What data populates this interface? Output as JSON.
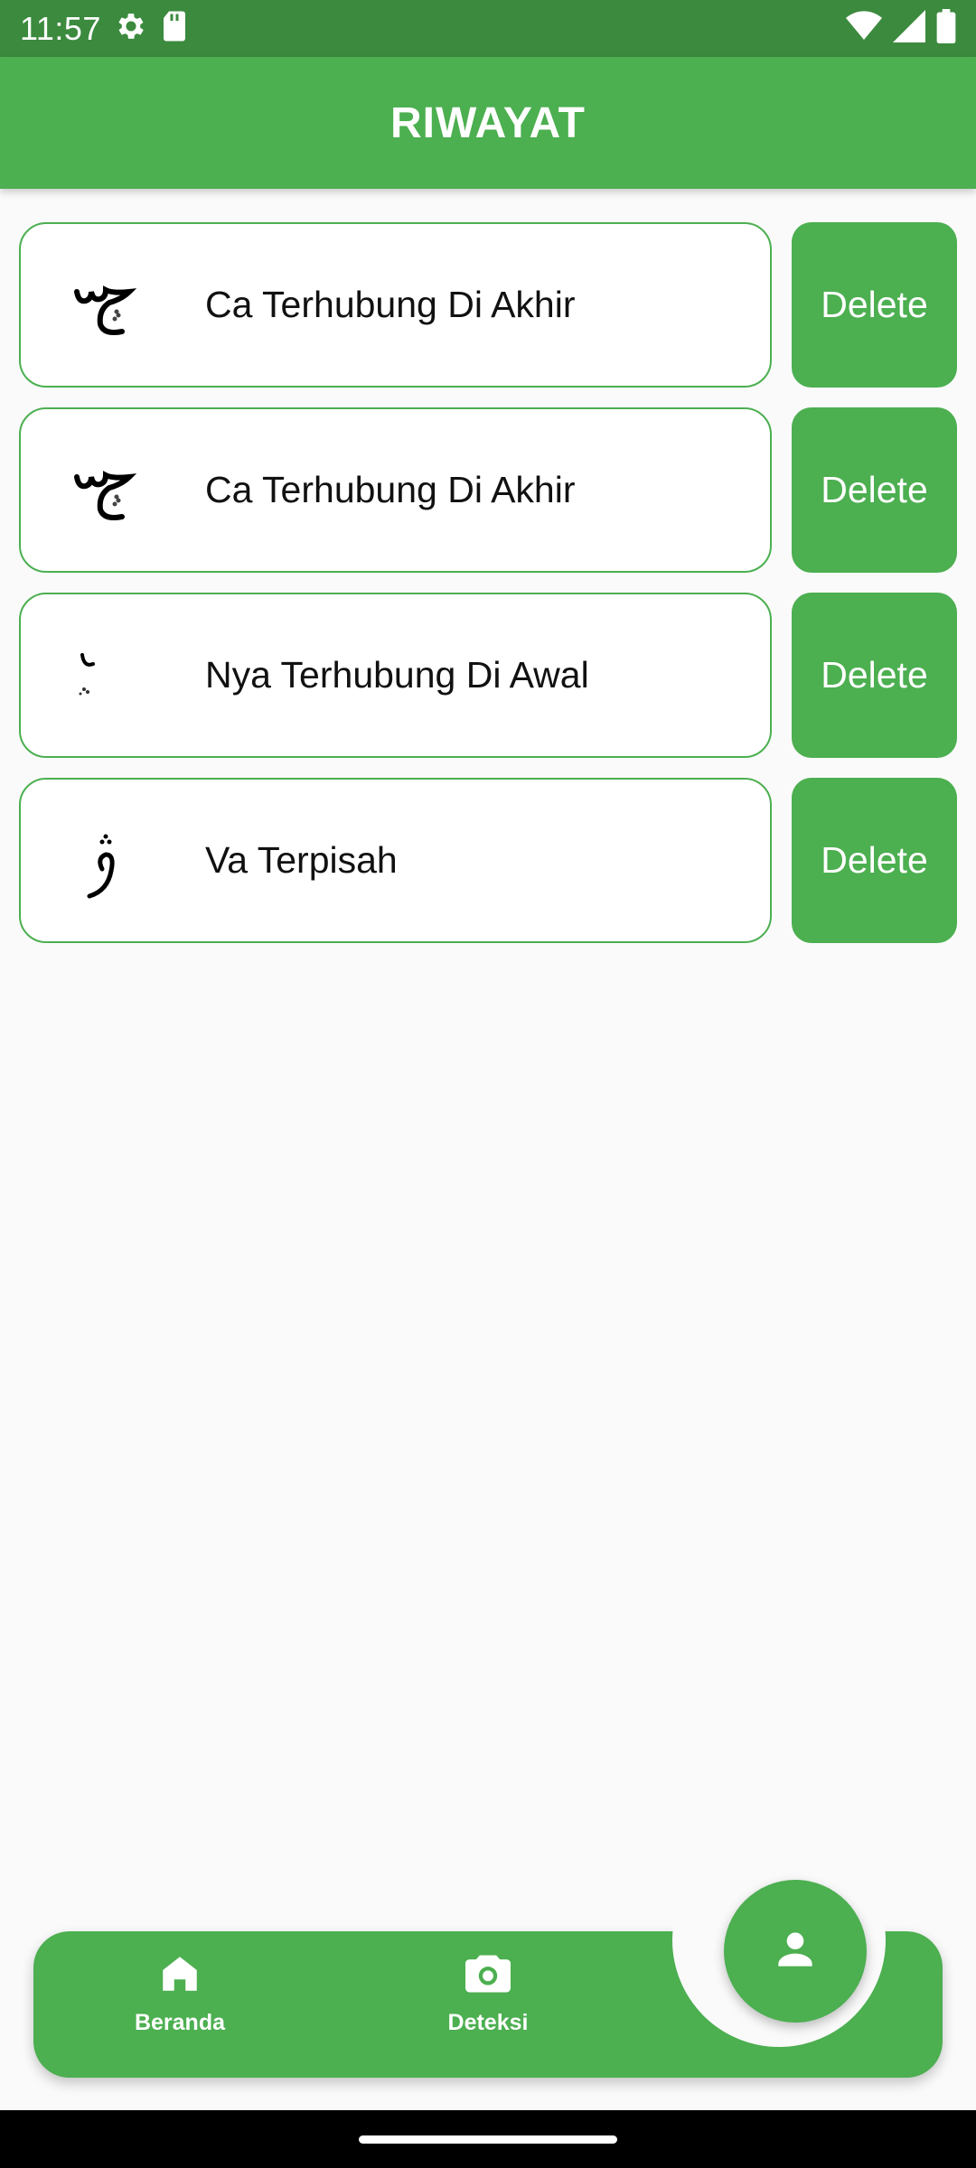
{
  "status_bar": {
    "time": "11:57",
    "left_icons": [
      "settings-icon",
      "sd-card-icon"
    ],
    "right_icons": [
      "wifi-icon",
      "signal-icon",
      "battery-icon"
    ]
  },
  "app_bar": {
    "title": "RIWAYAT"
  },
  "history": {
    "items": [
      {
        "label": "Ca Terhubung Di Akhir",
        "thumb": "arabic-letter-ca-final",
        "delete_label": "Delete"
      },
      {
        "label": "Ca Terhubung Di Akhir",
        "thumb": "arabic-letter-ca-final",
        "delete_label": "Delete"
      },
      {
        "label": "Nya Terhubung Di Awal",
        "thumb": "arabic-letter-nya-initial",
        "delete_label": "Delete"
      },
      {
        "label": "Va Terpisah",
        "thumb": "arabic-letter-va-isolated",
        "delete_label": "Delete"
      }
    ]
  },
  "bottom_nav": {
    "items": [
      {
        "label": "Beranda",
        "icon": "home-icon"
      },
      {
        "label": "Deteksi",
        "icon": "camera-icon"
      }
    ],
    "fab_icon": "person-icon"
  },
  "colors": {
    "primary": "#4caf50",
    "status_bar": "#3b8a3e",
    "background": "#fafafa",
    "text": "#111111"
  }
}
